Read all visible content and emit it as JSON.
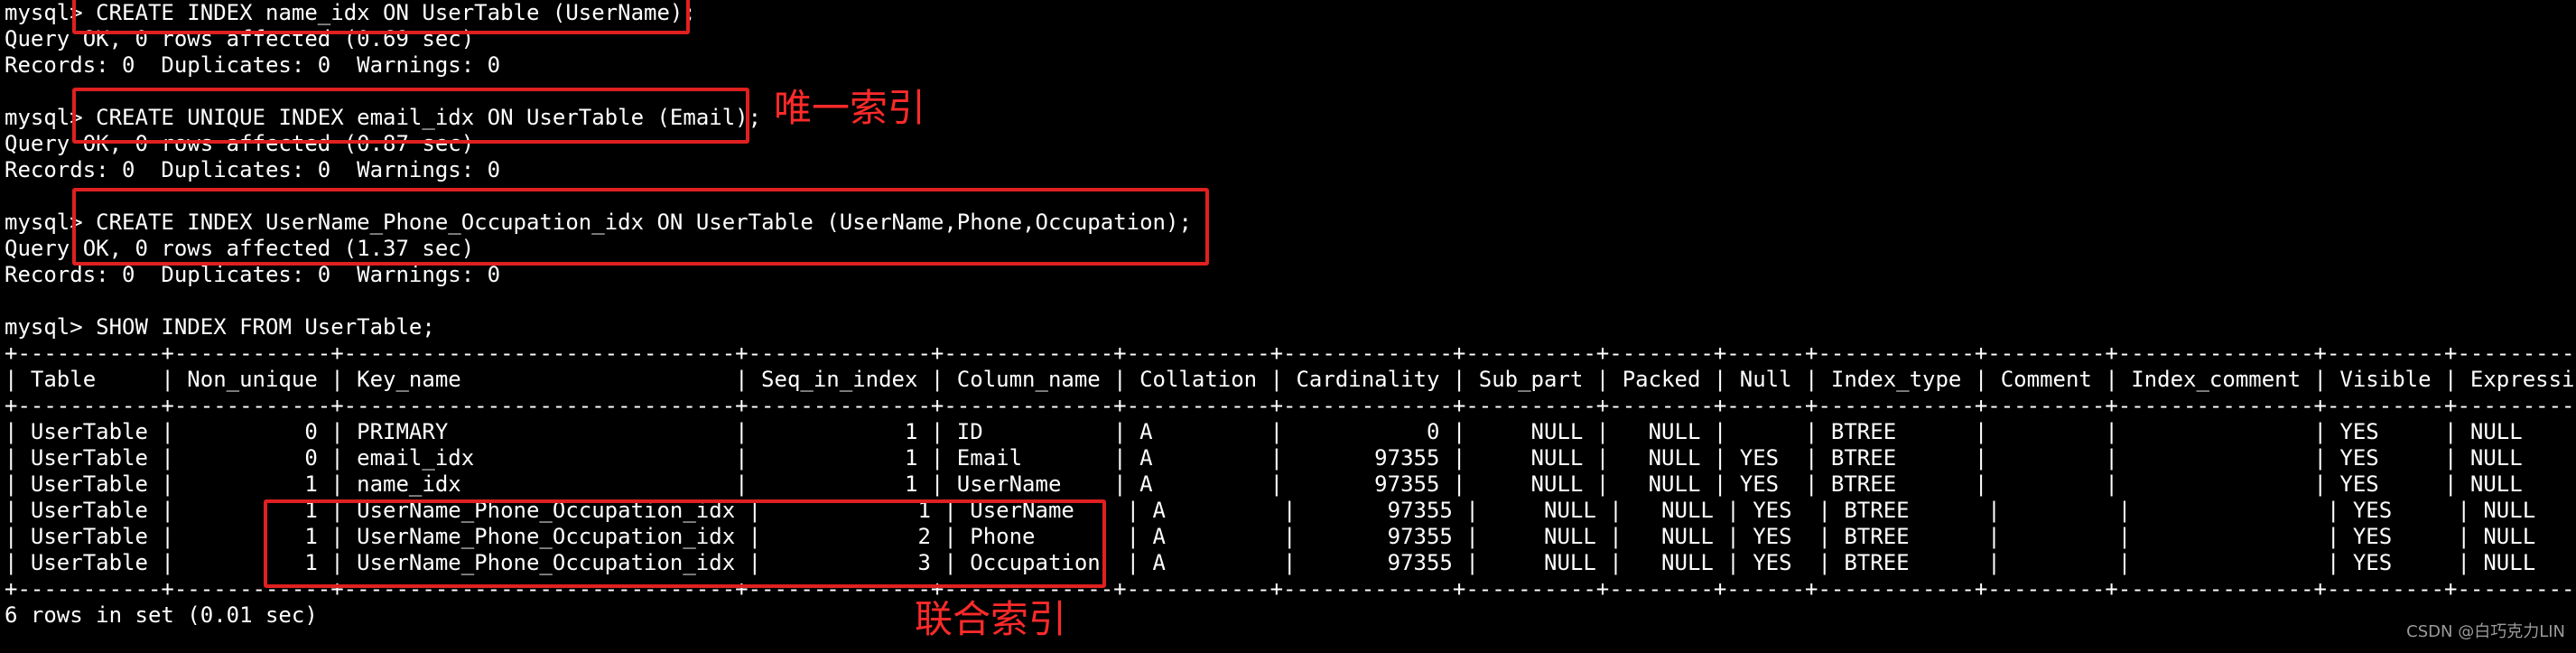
{
  "terminal": {
    "prompt": "mysql>",
    "statements": [
      {
        "command": " CREATE INDEX name_idx ON UserTable (UserName);",
        "result": "Query OK, 0 rows affected (0.69 sec)",
        "records": "Records: 0  Duplicates: 0  Warnings: 0"
      },
      {
        "command": " CREATE UNIQUE INDEX email_idx ON UserTable (Email);",
        "result": "Query OK, 0 rows affected (0.87 sec)",
        "records": "Records: 0  Duplicates: 0  Warnings: 0"
      },
      {
        "command": " CREATE INDEX UserName_Phone_Occupation_idx ON UserTable (UserName,Phone,Occupation);",
        "result": "Query OK, 0 rows affected (1.37 sec)",
        "records": "Records: 0  Duplicates: 0  Warnings: 0"
      }
    ],
    "show_command": " SHOW INDEX FROM UserTable;",
    "table": {
      "border": "+-----------+------------+------------------------------+--------------+-------------+-----------+-------------+----------+--------+------+------------+---------+---------------+---------+------------+",
      "header": "| Table     | Non_unique | Key_name                     | Seq_in_index | Column_name | Collation | Cardinality | Sub_part | Packed | Null | Index_type | Comment | Index_comment | Visible | Expression |",
      "rows": [
        "| UserTable |          0 | PRIMARY                      |            1 | ID          | A         |           0 |     NULL |   NULL |      | BTREE      |         |               | YES     | NULL       |",
        "| UserTable |          0 | email_idx                    |            1 | Email       | A         |       97355 |     NULL |   NULL | YES  | BTREE      |         |               | YES     | NULL       |",
        "| UserTable |          1 | name_idx                     |            1 | UserName    | A         |       97355 |     NULL |   NULL | YES  | BTREE      |         |               | YES     | NULL       |",
        "| UserTable |          1 | UserName_Phone_Occupation_idx |            1 | UserName    | A         |       97355 |     NULL |   NULL | YES  | BTREE      |         |               | YES     | NULL       |",
        "| UserTable |          1 | UserName_Phone_Occupation_idx |            2 | Phone       | A         |       97355 |     NULL |   NULL | YES  | BTREE      |         |               | YES     | NULL       |",
        "| UserTable |          1 | UserName_Phone_Occupation_idx |            3 | Occupation  | A         |       97355 |     NULL |   NULL | YES  | BTREE      |         |               | YES     | NULL       |"
      ]
    },
    "summary": "6 rows in set (0.01 sec)"
  },
  "annotations": {
    "unique_index": "唯一索引",
    "composite_index": "联合索引"
  },
  "watermark": "CSDN @白巧克力LIN",
  "colors": {
    "background": "#000000",
    "text": "#ffffff",
    "highlight_box": "#e02020",
    "annotation": "#ff2a2a",
    "watermark": "#9a9a9a"
  }
}
